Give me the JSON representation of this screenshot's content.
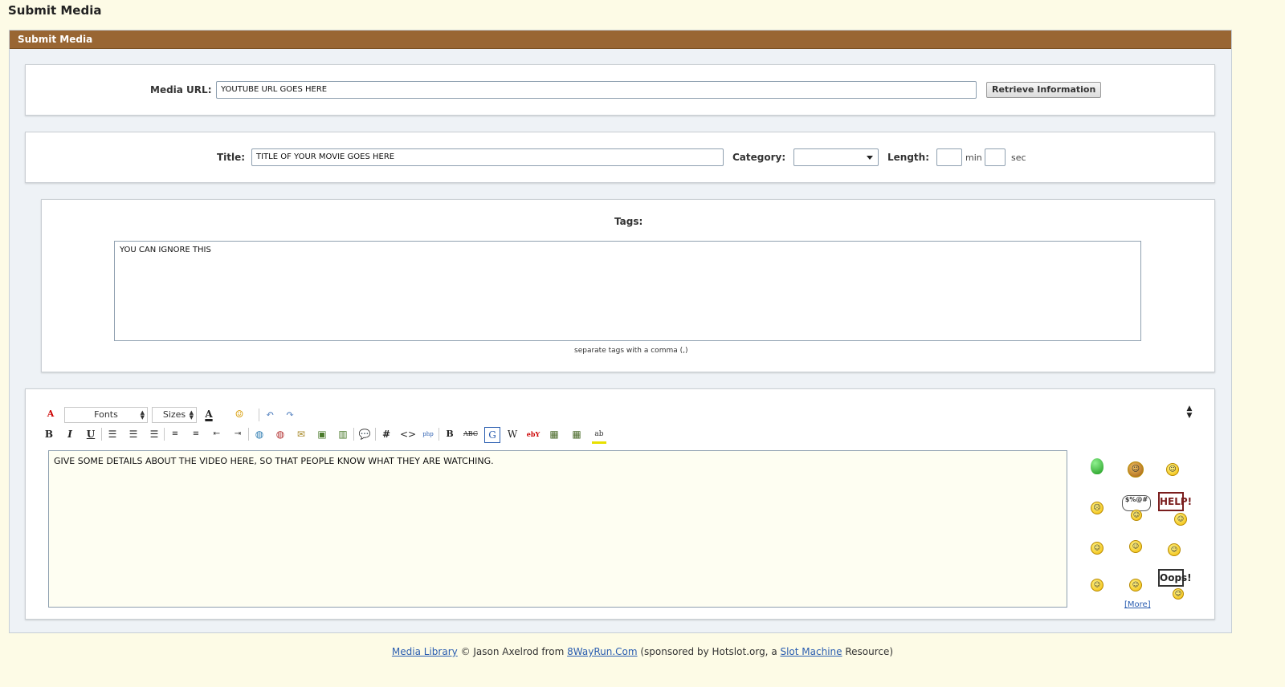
{
  "page": {
    "title": "Submit Media"
  },
  "panel": {
    "header": "Submit Media"
  },
  "media": {
    "url_label": "Media URL:",
    "url_value": "YOUTUBE URL GOES HERE",
    "retrieve_button": "Retrieve Information"
  },
  "details": {
    "title_label": "Title:",
    "title_value": "TITLE OF YOUR MOVIE GOES HERE",
    "category_label": "Category:",
    "category_value": "",
    "length_label": "Length:",
    "min_label": "min",
    "sec_label": "sec"
  },
  "tags": {
    "label": "Tags:",
    "value": "YOU CAN IGNORE THIS",
    "hint": "separate tags with a comma (,)"
  },
  "editor": {
    "fonts_select": "Fonts",
    "sizes_select": "Sizes",
    "content": "GIVE SOME DETAILS ABOUT THE VIDEO HERE, SO THAT PEOPLE KNOW WHAT THEY ARE WATCHING.",
    "more_link": "[More]",
    "sign_help": "HELP!",
    "sign_oops": "Oops!",
    "sign_cuss": "$%@#"
  },
  "footer": {
    "media_library": "Media Library",
    "copyright": " © Jason Axelrod from ",
    "site": "8WayRun.Com",
    "sponsored": " (sponsored by Hotslot.org, a ",
    "slot": "Slot Machine",
    "resource": " Resource)"
  }
}
